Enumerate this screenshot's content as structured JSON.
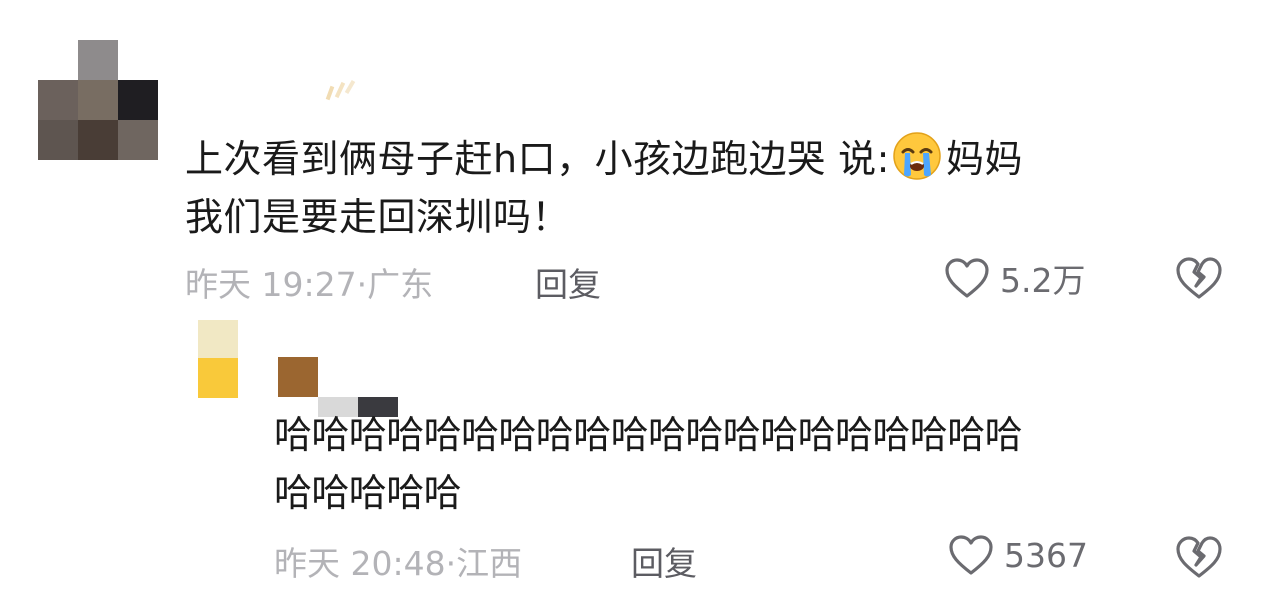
{
  "comment": {
    "text_line1_before_emoji": "上次看到俩母子赶h口，小孩边跑边哭 说:",
    "emoji": "crying-face",
    "text_line1_after_emoji": "妈妈",
    "text_line2": "我们是要走回深圳吗！",
    "time": "昨天 19:27",
    "location": "广东",
    "reply_label": "回复",
    "likes": "5.2万"
  },
  "reply": {
    "text_line1": "哈哈哈哈哈哈哈哈哈哈哈哈哈哈哈哈哈哈哈哈",
    "text_line2": "哈哈哈哈哈",
    "time": "昨天 20:48",
    "location": "江西",
    "reply_label": "回复",
    "likes": "5367"
  },
  "colors": {
    "text": "#1a1a1a",
    "meta": "#b3b3b7",
    "action": "#5c5c62",
    "icon_stroke": "#6b6b70"
  }
}
